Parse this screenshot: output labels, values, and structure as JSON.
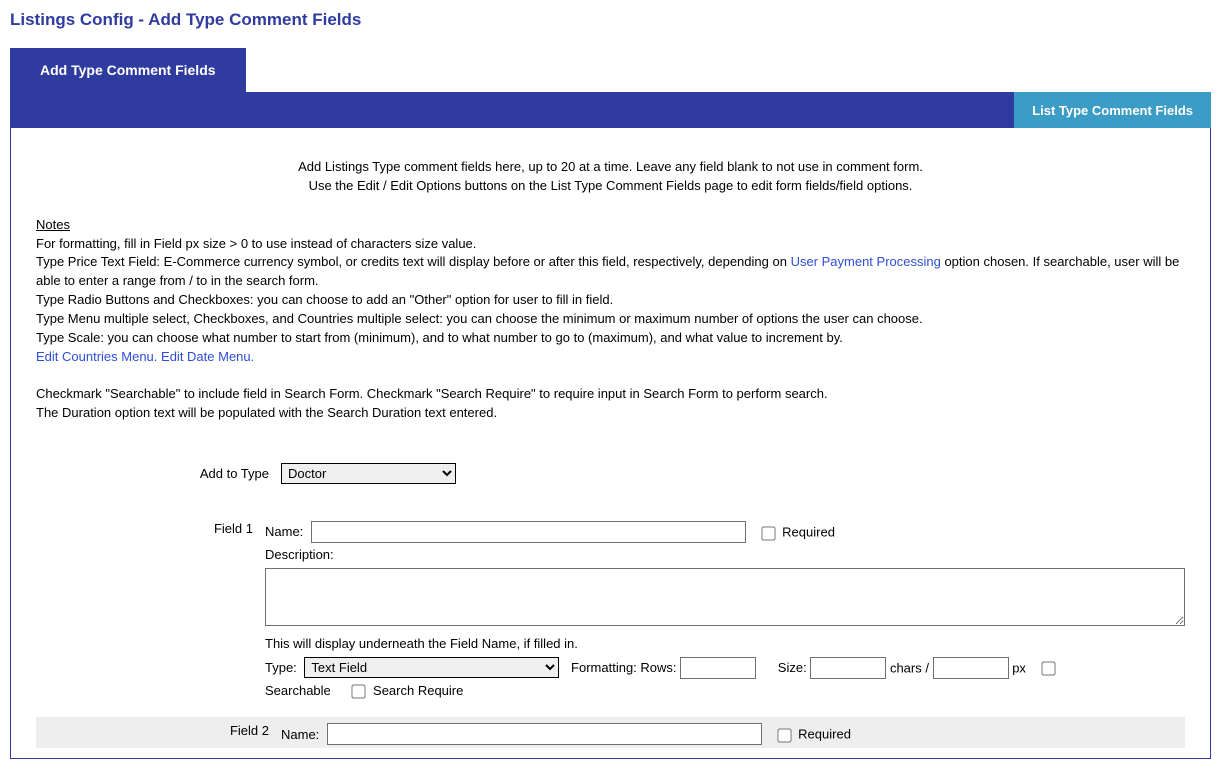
{
  "page_title": "Listings Config - Add Type Comment Fields",
  "tab_label": "Add Type Comment Fields",
  "toolbar_button": "List Type Comment Fields",
  "intro_line1": "Add Listings Type comment fields here, up to 20 at a time. Leave any field blank to not use in comment form.",
  "intro_line2": "Use the Edit / Edit Options buttons on the List Type Comment Fields page to edit form fields/field options.",
  "notes_heading": "Notes",
  "notes": {
    "formatting": "For formatting, fill in Field px size > 0 to use instead of characters size value.",
    "price_pre": "Type Price Text Field: E-Commerce currency symbol, or credits text will display before or after this field, respectively, depending on ",
    "price_link": "User Payment Processing",
    "price_post": " option chosen. If searchable, user will be able to enter a range from / to in the search form.",
    "radio": "Type Radio Buttons and Checkboxes: you can choose to add an \"Other\" option for user to fill in field.",
    "menu": "Type Menu multiple select, Checkboxes, and Countries multiple select: you can choose the minimum or maximum number of options the user can choose.",
    "scale": "Type Scale: you can choose what number to start from (minimum), and to what number to go to (maximum), and what value to increment by.",
    "edit_countries": "Edit Countries Menu.",
    "edit_date": "Edit Date Menu.",
    "search1": "Checkmark \"Searchable\" to include field in Search Form. Checkmark \"Search Require\" to require input in Search Form to perform search.",
    "search2": "The Duration option text will be populated with the Search Duration text entered."
  },
  "form": {
    "add_to_type_label": "Add to Type",
    "add_to_type_value": "Doctor",
    "field1_label": "Field 1",
    "field2_label": "Field 2",
    "name_label": "Name:",
    "required_label": "Required",
    "description_label": "Description:",
    "desc_hint": "This will display underneath the Field Name, if filled in.",
    "type_label": "Type:",
    "type_value": "Text Field",
    "formatting_label": "Formatting: Rows:",
    "size_label": "Size:",
    "chars_slash": "chars /",
    "px_label": "px",
    "searchable_label": "Searchable",
    "search_require_label": "Search Require"
  }
}
